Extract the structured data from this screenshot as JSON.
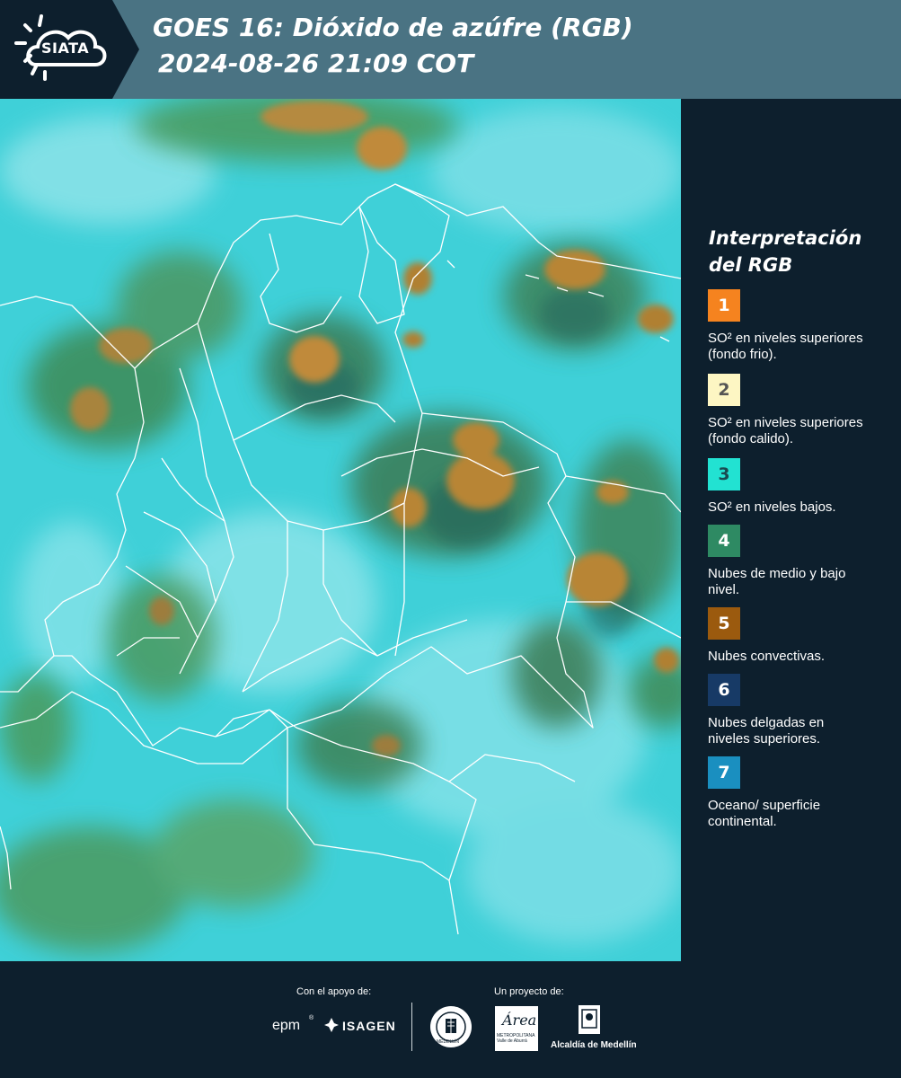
{
  "header": {
    "logo_text": "SIATA",
    "title_line1": "GOES 16: Dióxido de azúfre (RGB)",
    "title_line2": "2024-08-26 21:09 COT"
  },
  "legend": {
    "title_line1": "Interpretación",
    "title_line2": "del RGB",
    "items": [
      {
        "number": "1",
        "color": "#f5831f",
        "text_color": "#ffffff",
        "description": "SO² en niveles superiores (fondo frio)."
      },
      {
        "number": "2",
        "color": "#fdf6c3",
        "text_color": "#555555",
        "description": "SO² en niveles superiores (fondo calido)."
      },
      {
        "number": "3",
        "color": "#22e2d2",
        "text_color": "#1a4a50",
        "description": "SO² en niveles bajos."
      },
      {
        "number": "4",
        "color": "#2e8a63",
        "text_color": "#ffffff",
        "description": "Nubes de medio y bajo nivel."
      },
      {
        "number": "5",
        "color": "#9b5a0e",
        "text_color": "#ffffff",
        "description": "Nubes convectivas."
      },
      {
        "number": "6",
        "color": "#173a66",
        "text_color": "#ffffff",
        "description": "Nubes delgadas en niveles superiores."
      },
      {
        "number": "7",
        "color": "#1a8fc0",
        "text_color": "#ffffff",
        "description": "Oceano/ superficie continental."
      }
    ]
  },
  "footer": {
    "support_label": "Con el apoyo de:",
    "project_label": "Un proyecto de:",
    "sponsor1": "epm",
    "sponsor2": "ISAGEN",
    "partner1": "MEDELLÍN",
    "partner2": "Área",
    "partner2_sub": "METROPOLITANA Valle de Aburrá",
    "partner3": "Alcaldía de Medellín"
  },
  "colors": {
    "header_bg": "#4a7383",
    "panel_bg": "#0d1f2d",
    "map_base": "#3fd0d8",
    "cloud_green": "#3f8a52",
    "convective": "#b28535"
  }
}
